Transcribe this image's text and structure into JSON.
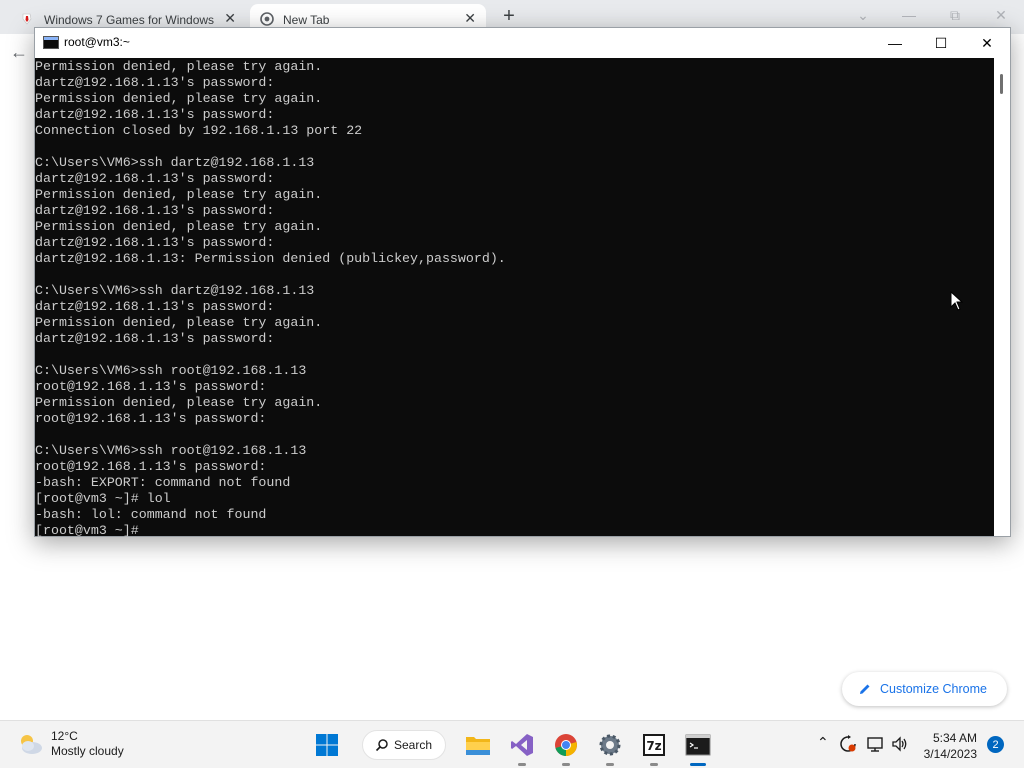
{
  "browser": {
    "tabs": [
      {
        "label": "Windows 7 Games for Windows"
      },
      {
        "label": "New Tab"
      }
    ],
    "customize_label": "Customize Chrome"
  },
  "terminal": {
    "title": "root@vm3:~",
    "lines": [
      "Permission denied, please try again.",
      "dartz@192.168.1.13's password:",
      "Permission denied, please try again.",
      "dartz@192.168.1.13's password:",
      "Connection closed by 192.168.1.13 port 22",
      "",
      "C:\\Users\\VM6>ssh dartz@192.168.1.13",
      "dartz@192.168.1.13's password:",
      "Permission denied, please try again.",
      "dartz@192.168.1.13's password:",
      "Permission denied, please try again.",
      "dartz@192.168.1.13's password:",
      "dartz@192.168.1.13: Permission denied (publickey,password).",
      "",
      "C:\\Users\\VM6>ssh dartz@192.168.1.13",
      "dartz@192.168.1.13's password:",
      "Permission denied, please try again.",
      "dartz@192.168.1.13's password:",
      "",
      "C:\\Users\\VM6>ssh root@192.168.1.13",
      "root@192.168.1.13's password:",
      "Permission denied, please try again.",
      "root@192.168.1.13's password:",
      "",
      "C:\\Users\\VM6>ssh root@192.168.1.13",
      "root@192.168.1.13's password:",
      "-bash: EXPORT: command not found",
      "[root@vm3 ~]# lol",
      "-bash: lol: command not found",
      "[root@vm3 ~]#"
    ]
  },
  "taskbar": {
    "weather_temp": "12°C",
    "weather_desc": "Mostly cloudy",
    "search_label": "Search",
    "time": "5:34 AM",
    "date": "3/14/2023",
    "notification_count": "2"
  },
  "colors": {
    "accent": "#0067c0",
    "terminal_bg": "#0c0c0c",
    "terminal_fg": "#cccccc",
    "chrome_link": "#1a73e8"
  }
}
